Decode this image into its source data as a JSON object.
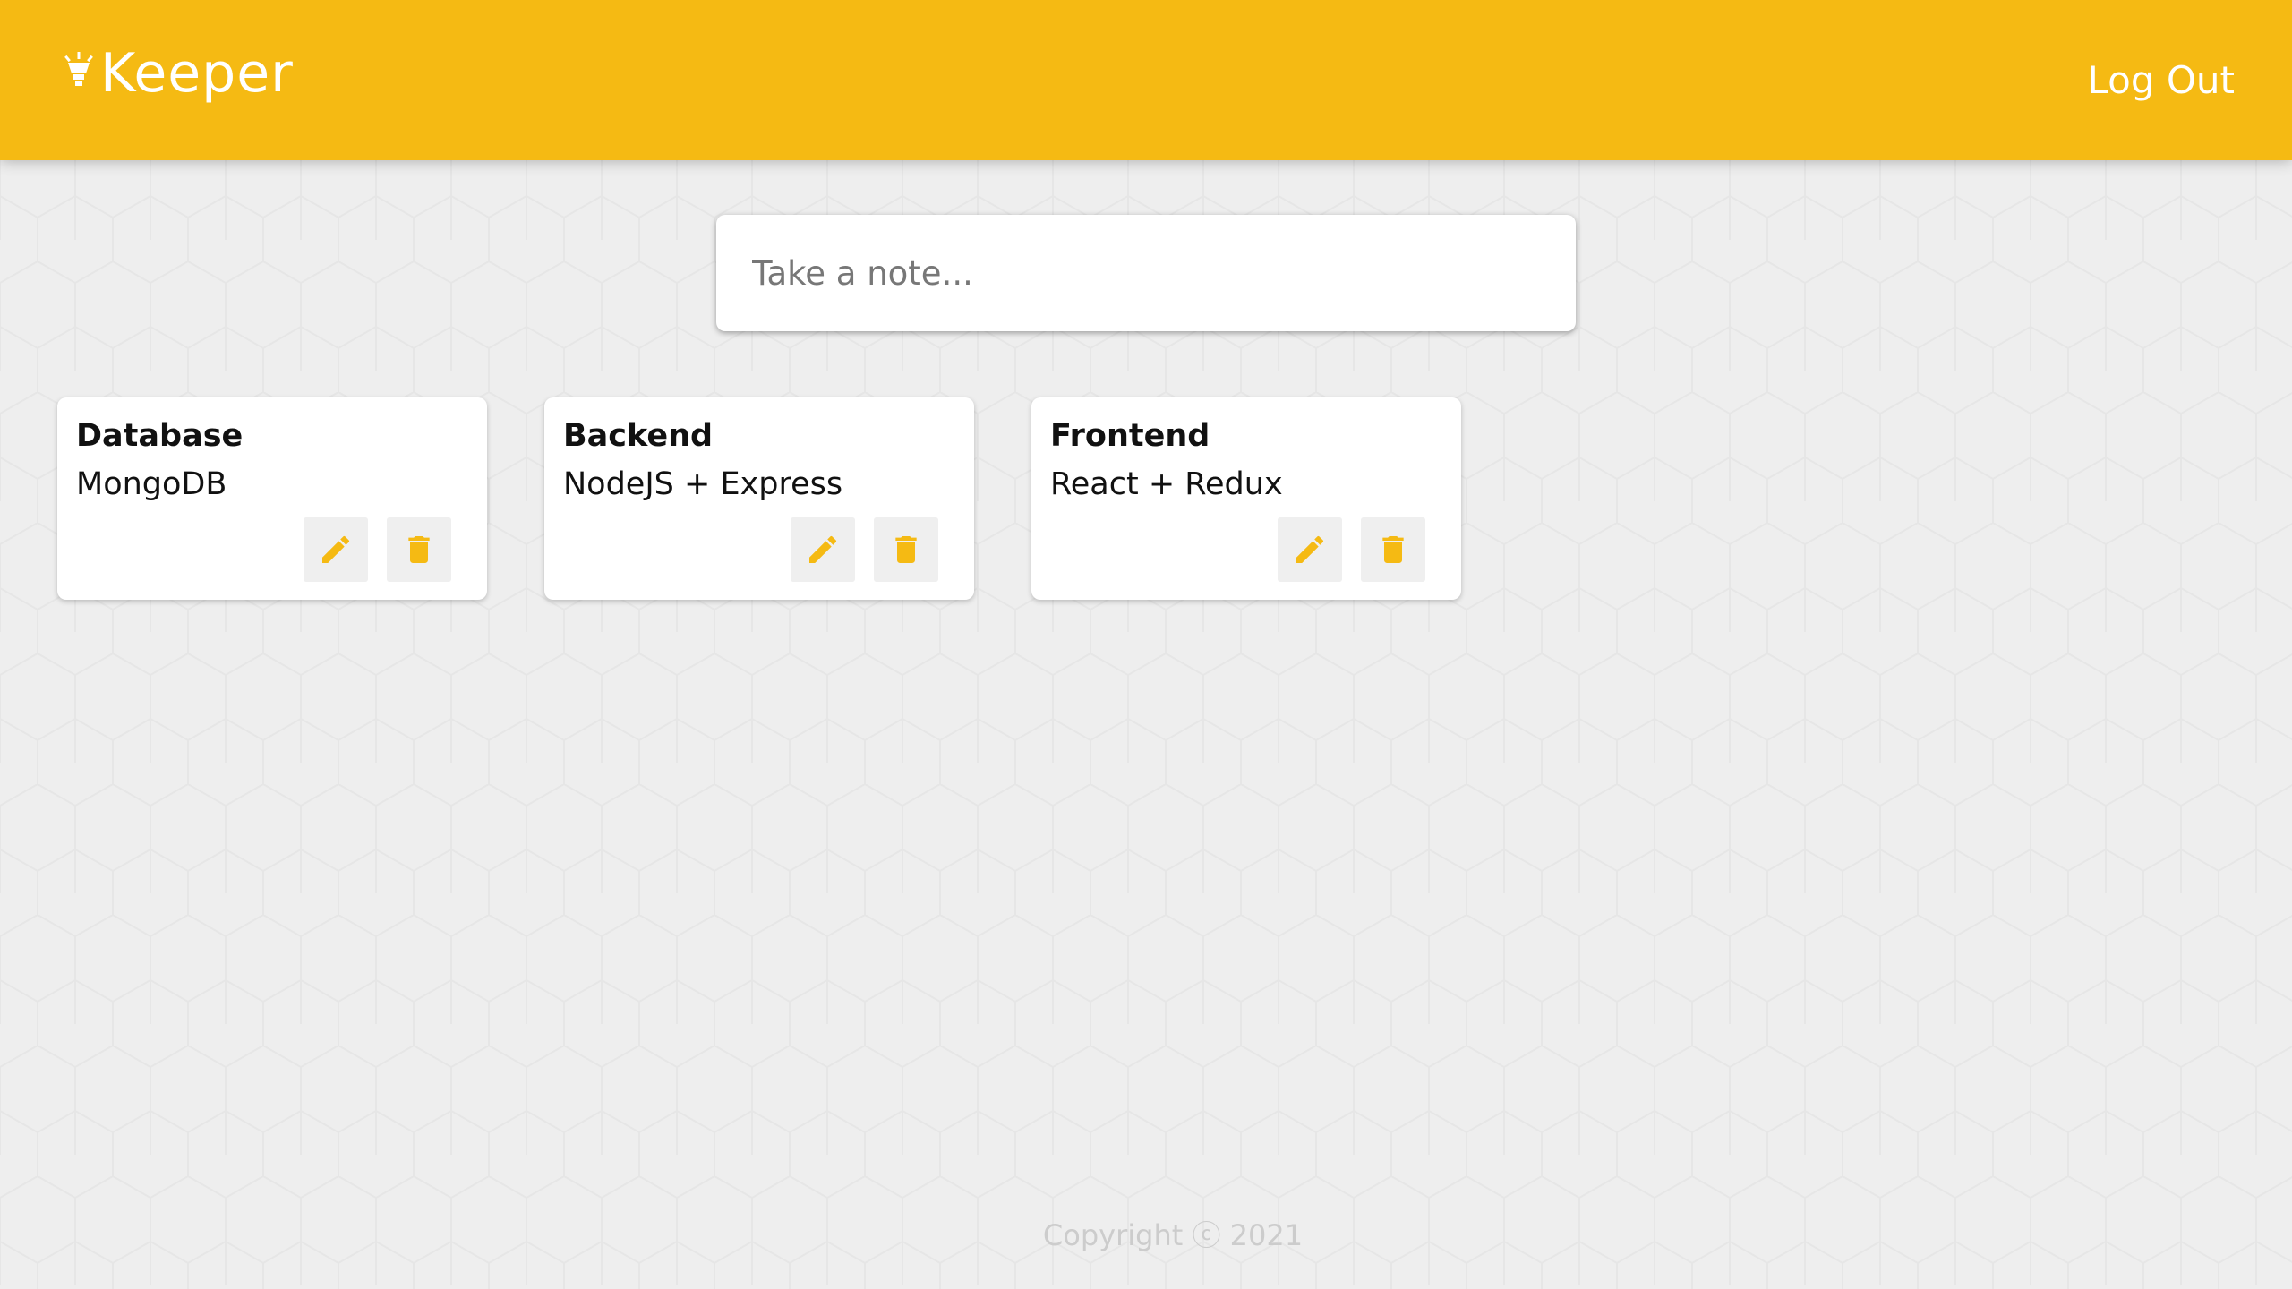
{
  "app": {
    "name": "Keeper",
    "accent_color": "#f5ba13",
    "background_color": "#eeeeee"
  },
  "header": {
    "logo_icon": "lightbulb-icon",
    "title": "Keeper",
    "logout_label": "Log Out"
  },
  "create_note": {
    "placeholder": "Take a note..."
  },
  "notes": [
    {
      "title": "Database",
      "content": "MongoDB",
      "edit_icon": "pencil-icon",
      "delete_icon": "trash-icon"
    },
    {
      "title": "Backend",
      "content": "NodeJS + Express",
      "edit_icon": "pencil-icon",
      "delete_icon": "trash-icon"
    },
    {
      "title": "Frontend",
      "content": "React + Redux",
      "edit_icon": "pencil-icon",
      "delete_icon": "trash-icon"
    }
  ],
  "footer": {
    "copyright": "Copyright ⓒ 2021"
  }
}
